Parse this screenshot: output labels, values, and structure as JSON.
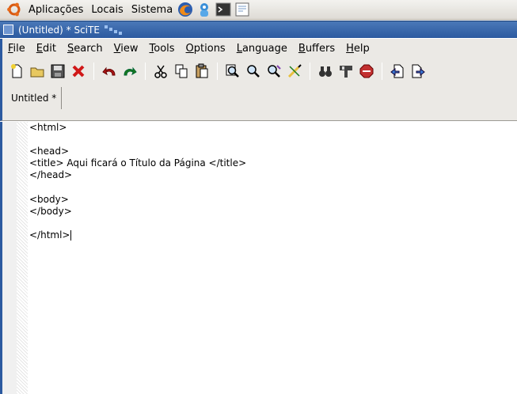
{
  "panel": {
    "menus": [
      "Aplicações",
      "Locais",
      "Sistema"
    ],
    "launchers": [
      "firefox-icon",
      "help-icon",
      "terminal-icon",
      "text-editor-icon"
    ]
  },
  "window": {
    "title": "(Untitled) * SciTE"
  },
  "menubar": [
    {
      "label": "File",
      "accel": "F",
      "rest": "ile"
    },
    {
      "label": "Edit",
      "accel": "E",
      "rest": "dit"
    },
    {
      "label": "Search",
      "accel": "S",
      "rest": "earch"
    },
    {
      "label": "View",
      "accel": "V",
      "rest": "iew"
    },
    {
      "label": "Tools",
      "accel": "T",
      "rest": "ools"
    },
    {
      "label": "Options",
      "accel": "O",
      "rest": "ptions"
    },
    {
      "label": "Language",
      "accel": "L",
      "rest": "anguage"
    },
    {
      "label": "Buffers",
      "accel": "B",
      "rest": "uffers"
    },
    {
      "label": "Help",
      "accel": "H",
      "rest": "elp"
    }
  ],
  "toolbar": {
    "groups": [
      [
        "new-file",
        "open-file",
        "save-file",
        "close-file"
      ],
      [
        "undo",
        "redo"
      ],
      [
        "cut",
        "copy",
        "paste"
      ],
      [
        "find",
        "find-next",
        "replace",
        "go-to"
      ],
      [
        "find-in-files",
        "build",
        "stop"
      ],
      [
        "previous-buffer",
        "next-buffer"
      ]
    ],
    "colors": {
      "close": "#d01818",
      "undo": "#b01818",
      "redo": "#1a7a1a",
      "new": "#f0d030",
      "stop": "#c23030"
    }
  },
  "tabs": [
    {
      "label": "Untitled *",
      "active": true
    }
  ],
  "editor": {
    "lines": [
      "<html>",
      "",
      "<head>",
      "<title> Aqui ficará o Título da Página </title>",
      "</head>",
      "",
      "<body>",
      "</body>",
      "",
      "</html>"
    ],
    "caret_line": 10
  }
}
